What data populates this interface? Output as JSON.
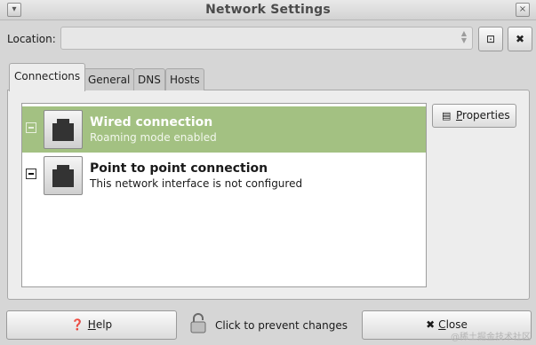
{
  "window": {
    "title": "Network Settings"
  },
  "location": {
    "label": "Location:",
    "value": ""
  },
  "tabs": [
    {
      "label": "Connections"
    },
    {
      "label": "General"
    },
    {
      "label": "DNS"
    },
    {
      "label": "Hosts"
    }
  ],
  "connections": [
    {
      "name": "Wired connection",
      "description": "Roaming mode enabled"
    },
    {
      "name": "Point to point connection",
      "description": "This network interface is not configured"
    }
  ],
  "properties_button": {
    "label_underlined": "P",
    "label_rest": "roperties"
  },
  "footer": {
    "help_underlined": "H",
    "help_rest": "elp",
    "lock_text": "Click to prevent changes",
    "close_underlined": "C",
    "close_rest": "lose"
  },
  "watermark": "@稀土掘金技术社区",
  "colors": {
    "selection": "#a3c182"
  }
}
